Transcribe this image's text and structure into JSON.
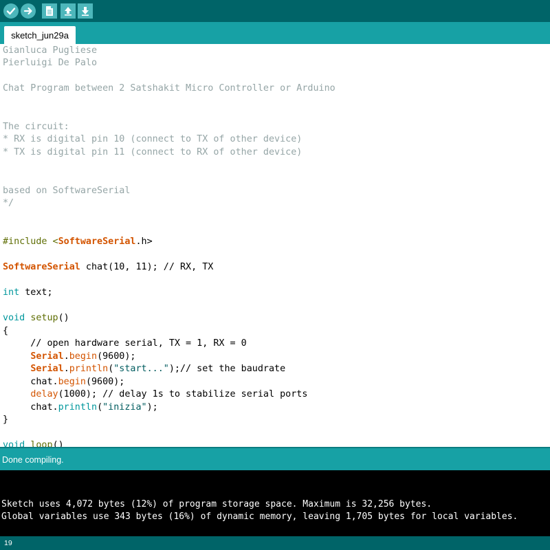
{
  "toolbar": {
    "buttons": [
      "verify",
      "upload",
      "new",
      "open",
      "save"
    ]
  },
  "tabs": [
    {
      "label": "sketch_jun29a"
    }
  ],
  "editor": {
    "lines": [
      {
        "text": "Gianluca Pugliese",
        "cls": "c-comment"
      },
      {
        "text": "Pierluigi De Palo",
        "cls": "c-comment"
      },
      {
        "text": "Chat Program between 2 Satshakit Micro Controller or Arduino",
        "cls": "c-comment"
      },
      {
        "text": "The circuit:",
        "cls": "c-comment"
      },
      {
        "text": "* RX is digital pin 10 (connect to TX of other device)",
        "cls": "c-comment"
      },
      {
        "text": "* TX is digital pin 11 (connect to RX of other device)",
        "cls": "c-comment"
      },
      {
        "text": "based on SoftwareSerial",
        "cls": "c-comment"
      },
      {
        "text": "*/",
        "cls": "c-comment"
      },
      {
        "text": "#include <SoftwareSerial.h>",
        "cls": "c-pre"
      },
      {
        "text": "SoftwareSerial chat(10, 11); // RX, TX",
        "cls": ""
      },
      {
        "text": "int text;",
        "cls": ""
      },
      {
        "text": "void setup()",
        "cls": ""
      },
      {
        "text": "{",
        "cls": ""
      },
      {
        "text": "     // open hardware serial, TX = 1, RX = 0",
        "cls": ""
      },
      {
        "text": "     Serial.begin(9600);",
        "cls": ""
      },
      {
        "text": "     Serial.println(\"start...\");// set the baudrate",
        "cls": ""
      },
      {
        "text": "     chat.begin(9600);",
        "cls": ""
      },
      {
        "text": "     delay(1000); // delay 1s to stabilize serial ports",
        "cls": ""
      },
      {
        "text": "     chat.println(\"inizia\");",
        "cls": ""
      },
      {
        "text": "}",
        "cls": ""
      },
      {
        "text": "void loop()",
        "cls": ""
      }
    ]
  },
  "status": {
    "message": "Done compiling."
  },
  "console": {
    "lines": [
      "Sketch uses 4,072 bytes (12%) of program storage space. Maximum is 32,256 bytes.",
      "Global variables use 343 bytes (16%) of dynamic memory, leaving 1,705 bytes for local variables."
    ]
  },
  "footer": {
    "line_number": "19"
  },
  "colors": {
    "toolbar_bg": "#006468",
    "tabbar_bg": "#17a1a5",
    "button_bg": "#4db7bb",
    "comment": "#95a5a6",
    "keyword_class": "#d35400",
    "keyword_type": "#00979c",
    "preprocessor": "#5e6d03"
  }
}
